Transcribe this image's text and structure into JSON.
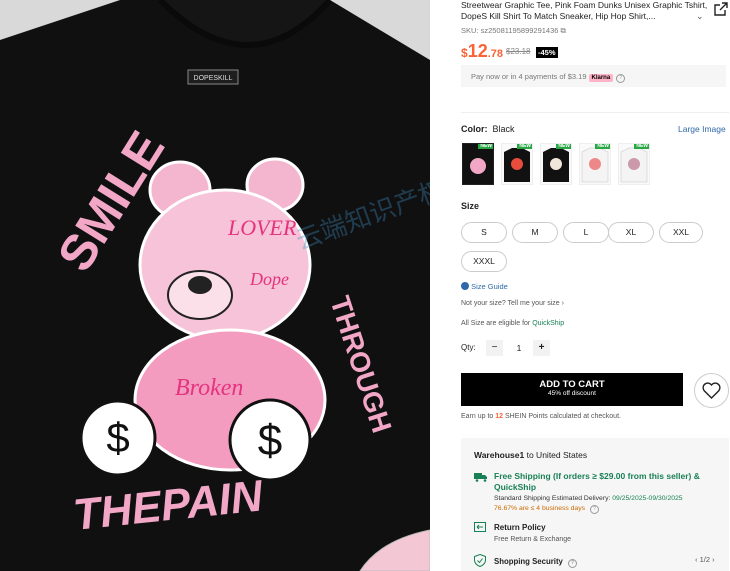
{
  "product": {
    "title": "Streetwear Graphic Tee, Pink Foam Dunks Unisex Graphic Tshirt, DopeS Kill Shirt To Match Sneaker, Hip Hop Shirt,...",
    "sku": "SKU: sz25081195899291436",
    "price_currency": "$",
    "price_int": "12",
    "price_dec": ".78",
    "original_price": "$23.18",
    "discount": "-45%",
    "payment_text": "Pay now or in 4 payments of $3.19",
    "klarna": "Klarna"
  },
  "shirt_art": {
    "top_left_text": "SMILE",
    "right_text": "THROUGH",
    "bottom_text": "THEPAIN",
    "collar_label": "DOPESKILL",
    "bear_texts": [
      "LOVER",
      "Dope",
      "Broken",
      "$",
      "$"
    ],
    "watermark": "云端知识产权大平台"
  },
  "color": {
    "label": "Color:",
    "value": "Black",
    "large_image_link": "Large Image",
    "new_badge": "NEW",
    "swatches": [
      "#111111",
      "#111111",
      "#111111",
      "#f4f4f4",
      "#f4f4f4"
    ]
  },
  "size": {
    "label": "Size",
    "options": [
      "S",
      "M",
      "L",
      "XL",
      "XXL",
      "XXXL"
    ],
    "guide": "Size Guide",
    "not_your_size": "Not your size? Tell me your size",
    "eligible_prefix": "All Size are eligible for",
    "quickship": "QuickShip"
  },
  "quantity": {
    "label": "Qty:",
    "minus": "−",
    "value": "1",
    "plus": "+"
  },
  "cart": {
    "button": "ADD TO CART",
    "sub": "45% off discount"
  },
  "points": {
    "prefix": "Earn up to",
    "count": "12",
    "suffix": "SHEIN Points calculated at checkout."
  },
  "shipping": {
    "warehouse": "Warehouse1",
    "to": "to United States",
    "free_shipping": "Free Shipping (If orders ≥ $29.00 from this seller) & QuickShip",
    "standard_label": "Standard Shipping Estimated Delivery:",
    "standard_dates": "09/25/2025-09/30/2025",
    "rate": "76.67% are ≤ 4 business days",
    "return_policy": "Return Policy",
    "return_sub": "Free Return & Exchange",
    "security": "Shopping Security",
    "pager": "1/2"
  },
  "colors": {
    "accent": "#fa6338",
    "green": "#198055",
    "link": "#2d68a8",
    "shirt": "#101010",
    "pink": "#f2a7c7"
  }
}
